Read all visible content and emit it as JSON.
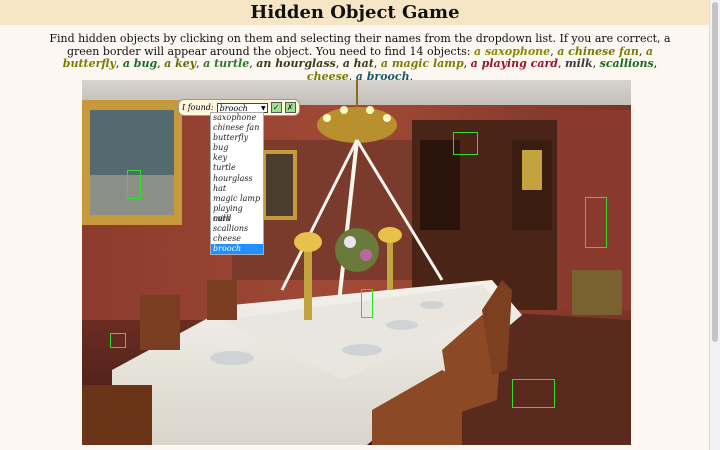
{
  "title": "Hidden Object Game",
  "instructions": {
    "lead": "Find hidden objects by clicking on them and selecting their names from the dropdown list. If you are correct, a green border will appear around the object. You need to find 14 objects: ",
    "sep": ", ",
    "end": "."
  },
  "objects": [
    {
      "label": "a saxophone",
      "cls": "c-sax"
    },
    {
      "label": "a chinese fan",
      "cls": "c-fan"
    },
    {
      "label": "a butterfly",
      "cls": "c-but"
    },
    {
      "label": "a bug",
      "cls": "c-bug"
    },
    {
      "label": "a key",
      "cls": "c-key"
    },
    {
      "label": "a turtle",
      "cls": "c-tur"
    },
    {
      "label": "an hourglass",
      "cls": "c-hour"
    },
    {
      "label": "a hat",
      "cls": "c-hat"
    },
    {
      "label": "a magic lamp",
      "cls": "c-lamp"
    },
    {
      "label": "a playing card",
      "cls": "c-card"
    },
    {
      "label": "milk",
      "cls": "c-milk"
    },
    {
      "label": "scallions",
      "cls": "c-scal"
    },
    {
      "label": "cheese",
      "cls": "c-che"
    },
    {
      "label": "a brooch",
      "cls": "c-bro"
    }
  ],
  "found_panel": {
    "label": "I found:",
    "selected": "brooch",
    "confirm_icon": "✓",
    "cancel_icon": "✗"
  },
  "dropdown_options": [
    "saxophone",
    "chinese fan",
    "butterfly",
    "bug",
    "key",
    "turtle",
    "hourglass",
    "hat",
    "magic lamp",
    "playing card",
    "milk",
    "scallions",
    "cheese",
    "brooch"
  ],
  "colors": {
    "found_border": "#2fe02f",
    "highlight": "#1e90ff",
    "header_bg": "#f7e6c6"
  }
}
